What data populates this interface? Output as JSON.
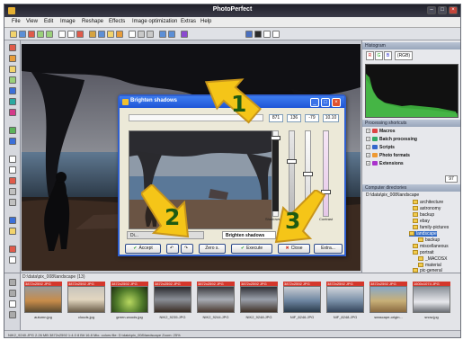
{
  "window": {
    "title": "PhotoPerfect"
  },
  "menu": [
    "File",
    "View",
    "Edit",
    "Image",
    "Reshape",
    "Effects",
    "Image optimization",
    "Extras",
    "Help"
  ],
  "icons": {
    "app": "app-icon",
    "minimize": "minimize-icon",
    "maximize": "maximize-icon",
    "close": "close-icon"
  },
  "right_panel": {
    "histogram_header": "Histogram",
    "channels": [
      "R",
      "G",
      "B"
    ],
    "channel_value": "(RGB)",
    "processing_header": "Processing shortcuts",
    "processing_items": [
      "Macros",
      "Batch processing",
      "Scripts",
      "Photo formats",
      "Extensions"
    ],
    "directories_header": "Computer directories",
    "path": "D:\\data\\pix_008\\landscape",
    "folders": [
      "architecture",
      "astronomy",
      "backup",
      "ebay",
      "family-pictures",
      "landscape",
      "backup",
      "miscellaneous",
      "portrait",
      "_MACOSX",
      "material",
      "pic-general"
    ],
    "scroll_value": "97"
  },
  "filmstrip": {
    "header": "D:\\data\\pix_008\\landscape (13)",
    "thumbs": [
      {
        "dim": "3872x2592 JPG",
        "caption": "autumn.jpg"
      },
      {
        "dim": "3872x2592 JPG",
        "caption": "clouds.jpg"
      },
      {
        "dim": "3872x2592 JPG",
        "caption": "green-woods.jpg"
      },
      {
        "dim": "3872x2592 JPG",
        "caption": "NIK2_9235.JPG"
      },
      {
        "dim": "3872x2592 JPG",
        "caption": "NIK2_9244.JPG"
      },
      {
        "dim": "3872x2592 JPG",
        "caption": "NIK2_9248.JPG"
      },
      {
        "dim": "3872x2592 JPG",
        "caption": "NIF_8246.JPG"
      },
      {
        "dim": "3872x2592 JPG",
        "caption": "NIF_8248.JPG"
      },
      {
        "dim": "3872x2592 JPG",
        "caption": "seascape-origin..."
      },
      {
        "dim": "1600x1074 JPG",
        "caption": "snow.jpg"
      }
    ]
  },
  "statusbar": "NIK2_9240.JPG   2.26 MB   3872x2592   1:4.0   8 Bit   16.8 Mio. colors   file: D:\\data\\pix_008\\landscape   Zoom: 25%",
  "dialog": {
    "title": "Brighten shadows",
    "values": [
      "871",
      "136",
      "-79",
      "10.10"
    ],
    "slider_labels": [
      "Shadows",
      "Contrast"
    ],
    "tabs": [
      "Di...",
      "Brighten shadows"
    ],
    "buttons": {
      "accept": "Accept",
      "zoom": "Zero s.",
      "execute": "Execute",
      "close": "Close",
      "extras": "Extra..."
    }
  },
  "callouts": [
    "1",
    "2",
    "3"
  ],
  "colors": {
    "callout": "#f5c518",
    "dialog_title": "#2f5fd0",
    "accent_red": "#d4372c"
  }
}
